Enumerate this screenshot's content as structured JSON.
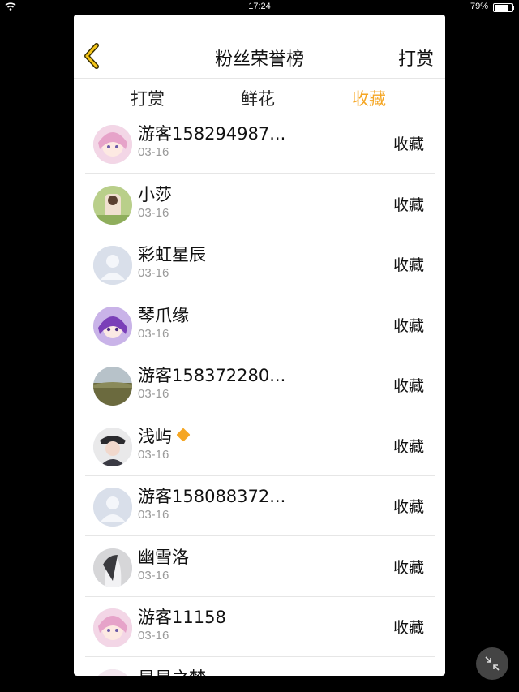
{
  "status_bar": {
    "time": "17:24",
    "battery_text": "79%",
    "battery_level": 0.79
  },
  "header": {
    "title": "粉丝荣誉榜",
    "right_action": "打赏"
  },
  "tabs": [
    {
      "label": "打赏",
      "active": false
    },
    {
      "label": "鲜花",
      "active": false
    },
    {
      "label": "收藏",
      "active": true
    }
  ],
  "colors": {
    "accent": "#f5a623",
    "date_text": "#9a9a9a",
    "divider": "#e6e6e6"
  },
  "fans": [
    {
      "name": "游客158294987...",
      "date": "03-16",
      "action": "收藏",
      "avatar": "anime-girl-pink"
    },
    {
      "name": "小莎",
      "date": "03-16",
      "action": "收藏",
      "avatar": "photo-green"
    },
    {
      "name": "彩虹星辰",
      "date": "03-16",
      "action": "收藏",
      "avatar": "default-user"
    },
    {
      "name": "琴爪缘",
      "date": "03-16",
      "action": "收藏",
      "avatar": "anime-girl-purple"
    },
    {
      "name": "游客158372280...",
      "date": "03-16",
      "action": "收藏",
      "avatar": "landscape"
    },
    {
      "name": "浅屿",
      "date": "03-16",
      "action": "收藏",
      "avatar": "photo-person",
      "badge": "diamond-icon"
    },
    {
      "name": "游客158088372...",
      "date": "03-16",
      "action": "收藏",
      "avatar": "default-user"
    },
    {
      "name": "幽雪洛",
      "date": "03-16",
      "action": "收藏",
      "avatar": "photo-gray"
    },
    {
      "name": "游客11158",
      "date": "03-16",
      "action": "收藏",
      "avatar": "anime-girl-pink"
    },
    {
      "name": "星星之梦",
      "date": "",
      "action": "",
      "avatar": "anime-girl-light"
    }
  ]
}
